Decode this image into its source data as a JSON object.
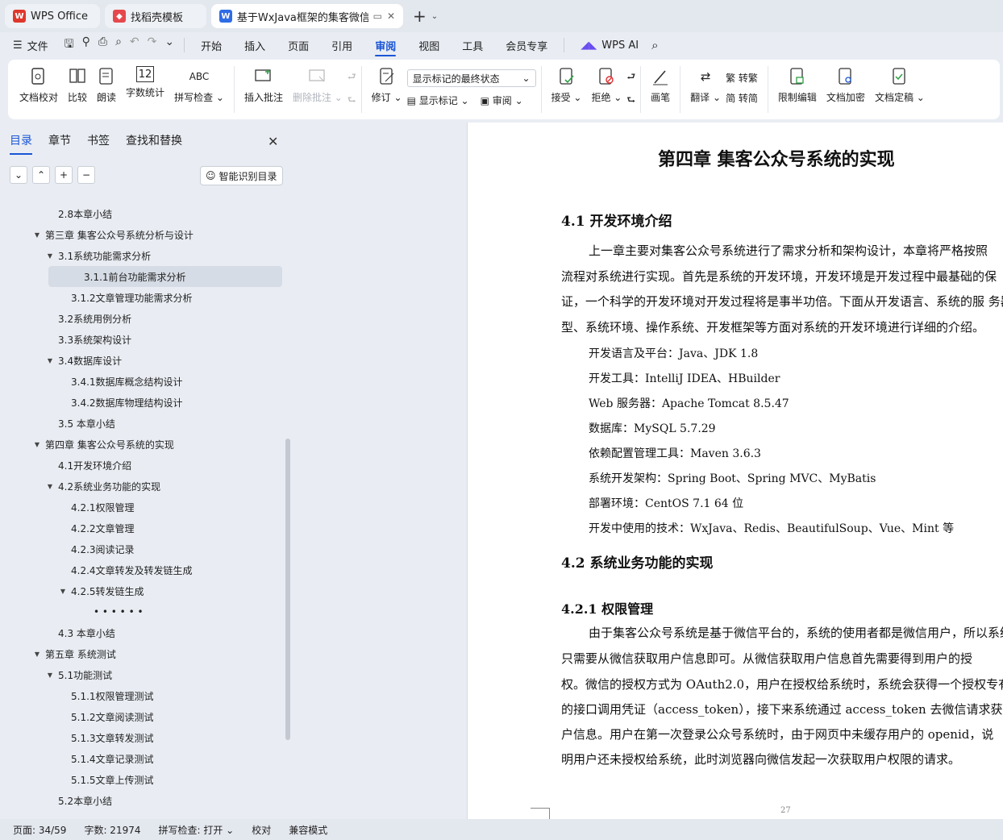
{
  "tabs": [
    {
      "title": "WPS Office",
      "icon": "wps-logo-icon",
      "color": "#e0372c"
    },
    {
      "title": "找稻壳模板",
      "icon": "docer-logo-icon",
      "color": "#e5484d"
    },
    {
      "title": "基于WxJava框架的集客微信公",
      "icon": "writer-logo-icon",
      "color": "#2f6ce5"
    }
  ],
  "menu": {
    "file_label": "文件",
    "items": [
      "开始",
      "插入",
      "页面",
      "引用",
      "审阅",
      "视图",
      "工具",
      "会员专享"
    ],
    "active": "审阅",
    "ai_label": "WPS AI"
  },
  "ribbon": {
    "doc_check": "文档校对",
    "compare": "比较",
    "read_aloud": "朗读",
    "word_count": "字数统计",
    "spell_check": "拼写检查",
    "insert_comment": "插入批注",
    "delete_comment": "删除批注",
    "revise": "修订",
    "markup_select": "显示标记的最终状态",
    "show_markup": "显示标记",
    "review": "审阅",
    "accept": "接受",
    "reject": "拒绝",
    "pen": "画笔",
    "translate": "翻译",
    "to_traditional": "转繁",
    "to_simplified": "转简",
    "restrict_edit": "限制编辑",
    "encrypt": "文档加密",
    "finalize": "文档定稿"
  },
  "panel": {
    "tabs": [
      "目录",
      "章节",
      "书签",
      "查找和替换"
    ],
    "smart_toc": "智能识别目录",
    "toc": [
      {
        "text": "2.8本章小结",
        "level": 2,
        "tri": ""
      },
      {
        "text": "第三章 集客公众号系统分析与设计",
        "level": 1,
        "tri": "▼"
      },
      {
        "text": "3.1系统功能需求分析",
        "level": 2,
        "tri": "▼"
      },
      {
        "text": "3.1.1前台功能需求分析",
        "level": 3,
        "tri": "",
        "selected": true
      },
      {
        "text": "3.1.2文章管理功能需求分析",
        "level": 3,
        "tri": ""
      },
      {
        "text": "3.2系统用例分析",
        "level": 2,
        "tri": ""
      },
      {
        "text": "3.3系统架构设计",
        "level": 2,
        "tri": ""
      },
      {
        "text": "3.4数据库设计",
        "level": 2,
        "tri": "▼"
      },
      {
        "text": "3.4.1数据库概念结构设计",
        "level": 3,
        "tri": ""
      },
      {
        "text": "3.4.2数据库物理结构设计",
        "level": 3,
        "tri": ""
      },
      {
        "text": "3.5 本章小结",
        "level": 2,
        "tri": ""
      },
      {
        "text": "第四章 集客公众号系统的实现",
        "level": 1,
        "tri": "▼"
      },
      {
        "text": "4.1开发环境介绍",
        "level": 2,
        "tri": ""
      },
      {
        "text": "4.2系统业务功能的实现",
        "level": 2,
        "tri": "▼"
      },
      {
        "text": "4.2.1权限管理",
        "level": 3,
        "tri": ""
      },
      {
        "text": "4.2.2文章管理",
        "level": 3,
        "tri": ""
      },
      {
        "text": "4.2.3阅读记录",
        "level": 3,
        "tri": ""
      },
      {
        "text": "4.2.4文章转发及转发链生成",
        "level": 3,
        "tri": ""
      },
      {
        "text": "4.2.5转发链生成",
        "level": 3,
        "tri": "▼"
      },
      {
        "text": "• • • • • •",
        "level": 4,
        "tri": ""
      },
      {
        "text": "4.3 本章小结",
        "level": 2,
        "tri": ""
      },
      {
        "text": "第五章 系统测试",
        "level": 1,
        "tri": "▼"
      },
      {
        "text": "5.1功能测试",
        "level": 2,
        "tri": "▼"
      },
      {
        "text": "5.1.1权限管理测试",
        "level": 3,
        "tri": ""
      },
      {
        "text": "5.1.2文章阅读测试",
        "level": 3,
        "tri": ""
      },
      {
        "text": "5.1.3文章转发测试",
        "level": 3,
        "tri": ""
      },
      {
        "text": "5.1.4文章记录测试",
        "level": 3,
        "tri": ""
      },
      {
        "text": "5.1.5文章上传测试",
        "level": 3,
        "tri": ""
      },
      {
        "text": "5.2本章小结",
        "level": 2,
        "tri": ""
      }
    ]
  },
  "doc": {
    "chapter_title": "第四章  集客公众号系统的实现",
    "s41": "4.1    开发环境介绍",
    "p1": [
      "上一章主要对集客公众号系统进行了需求分析和架构设计，本章将严格按照",
      "流程对系统进行实现。首先是系统的开发环境，开发环境是开发过程中最基础的保",
      "证，一个科学的开发环境对开发过程将是事半功倍。下面从开发语言、系统的服  务器类",
      "型、系统环境、操作系统、开发框架等方面对系统的开发环境进行详细的介绍。"
    ],
    "env": [
      "开发语言及平台：Java、JDK 1.8",
      "开发工具：IntelliJ IDEA、HBuilder",
      "Web 服务器：Apache Tomcat 8.5.47",
      "数据库：MySQL 5.7.29",
      "依赖配置管理工具：Maven 3.6.3",
      "系统开发架构：Spring Boot、Spring MVC、MyBatis",
      "部署环境：CentOS 7.1 64 位",
      "开发中使用的技术：WxJava、Redis、BeautifulSoup、Vue、Mint 等"
    ],
    "s42": "4.2    系统业务功能的实现",
    "s421": "4.2.1    权限管理",
    "p2": [
      "由于集客公众号系统是基于微信平台的，系统的使用者都是微信用户，所以系统",
      "只需要从微信获取用户信息即可。从微信获取用户信息首先需要得到用户的授",
      "权。微信的授权方式为 OAuth2.0，用户在授权给系统时，系统会获得一个授权专有",
      "的接口调用凭证（access_token），接下来系统通过 access_token 去微信请求获取用",
      "户信息。用户在第一次登录公众号系统时，由于网页中未缓存用户的 openid，说",
      "明用户还未授权给系统，此时浏览器向微信发起一次获取用户权限的请求。"
    ],
    "page_number": "27"
  },
  "status": {
    "page": "页面: 34/59",
    "words": "字数: 21974",
    "spell": "拼写检查: 打开",
    "proof": "校对",
    "compat": "兼容模式"
  }
}
